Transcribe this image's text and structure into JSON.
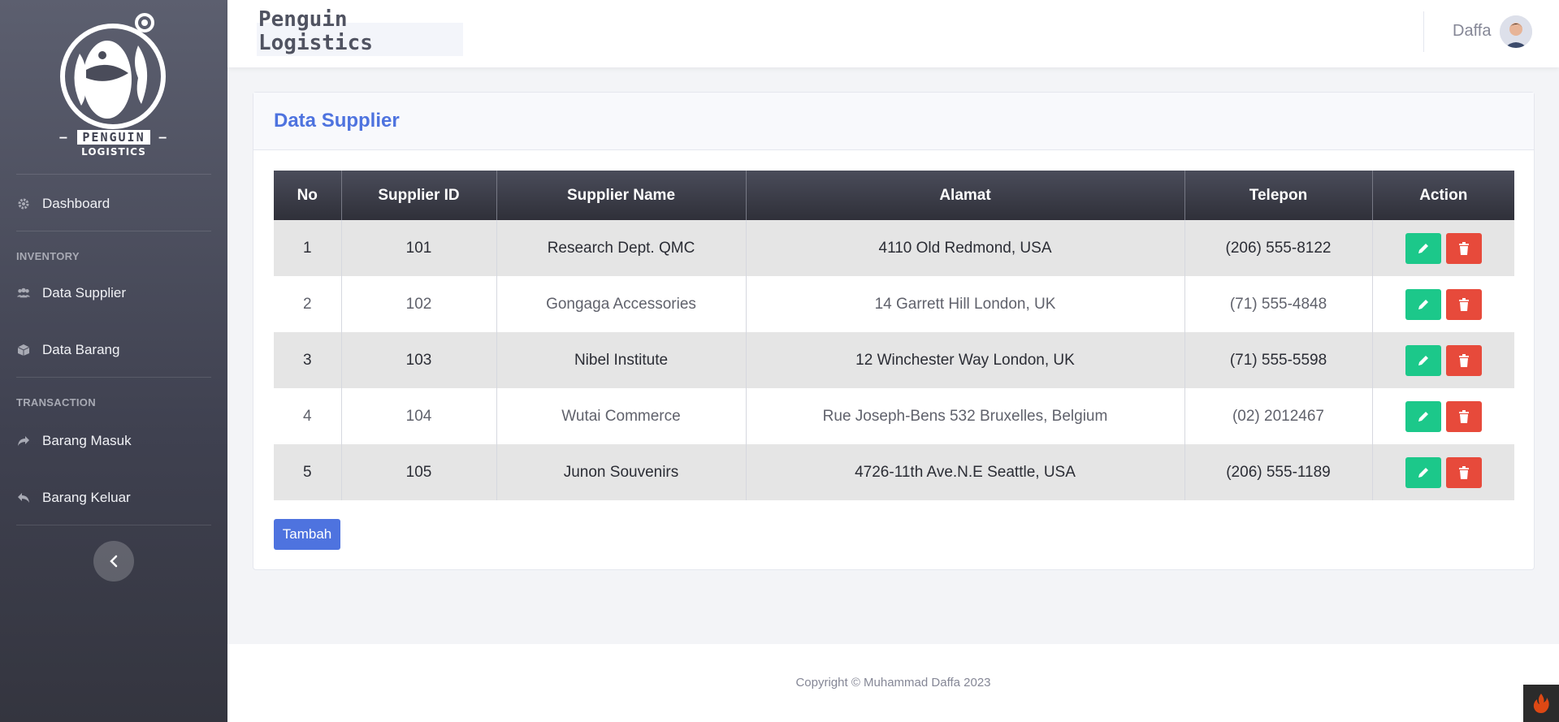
{
  "sidebar": {
    "logo_text_top": "PENGUIN",
    "logo_text_bottom": "LOGISTICS",
    "items": [
      {
        "label": "Dashboard",
        "icon": "gear-icon"
      },
      {
        "label": "Data Supplier",
        "icon": "users-icon"
      },
      {
        "label": "Data Barang",
        "icon": "box-icon"
      },
      {
        "label": "Barang Masuk",
        "icon": "share-icon"
      },
      {
        "label": "Barang Keluar",
        "icon": "reply-icon"
      }
    ],
    "headings": {
      "inventory": "INVENTORY",
      "transaction": "TRANSACTION"
    }
  },
  "topbar": {
    "title_line1": "Penguin",
    "title_line2": "Logistics",
    "user_name": "Daffa"
  },
  "card": {
    "title": "Data Supplier",
    "columns": [
      "No",
      "Supplier ID",
      "Supplier Name",
      "Alamat",
      "Telepon",
      "Action"
    ],
    "rows": [
      {
        "no": "1",
        "id": "101",
        "name": "Research Dept. QMC",
        "alamat": "4110 Old Redmond, USA",
        "telepon": "(206) 555-8122"
      },
      {
        "no": "2",
        "id": "102",
        "name": "Gongaga Accessories",
        "alamat": "14 Garrett Hill London, UK",
        "telepon": "(71) 555-4848"
      },
      {
        "no": "3",
        "id": "103",
        "name": "Nibel Institute",
        "alamat": "12 Winchester Way London, UK",
        "telepon": "(71) 555-5598"
      },
      {
        "no": "4",
        "id": "104",
        "name": "Wutai Commerce",
        "alamat": "Rue Joseph-Bens 532 Bruxelles, Belgium",
        "telepon": "(02) 2012467"
      },
      {
        "no": "5",
        "id": "105",
        "name": "Junon Souvenirs",
        "alamat": "4726-11th Ave.N.E Seattle, USA",
        "telepon": "(206) 555-1189"
      }
    ],
    "add_button": "Tambah"
  },
  "footer": {
    "copyright": "Copyright © Muhammad Daffa 2023"
  },
  "colors": {
    "accent": "#4e73df",
    "edit": "#1cc88a",
    "delete": "#e74a3b",
    "sidebar": "#4a4c5a"
  }
}
